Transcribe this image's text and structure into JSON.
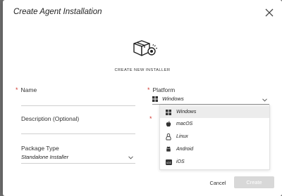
{
  "dialog": {
    "title": "Create Agent Installation",
    "hero_caption": "CREATE NEW INSTALLER"
  },
  "form": {
    "name": {
      "label": "Name",
      "required": "*"
    },
    "description": {
      "label": "Description (Optional)"
    },
    "package_type": {
      "label": "Package Type",
      "value": "Standalone Installer"
    },
    "platform": {
      "label": "Platform",
      "required": "*",
      "value": "Windows",
      "second_required": "*",
      "options": [
        {
          "label": "Windows",
          "icon": "windows-icon",
          "selected": true
        },
        {
          "label": "macOS",
          "icon": "apple-icon"
        },
        {
          "label": "Linux",
          "icon": "linux-icon"
        },
        {
          "label": "Android",
          "icon": "android-icon"
        },
        {
          "label": "iOS",
          "icon": "ios-icon"
        }
      ]
    }
  },
  "footer": {
    "cancel_label": "Cancel",
    "create_label": "Create"
  },
  "colors": {
    "required": "#d0342c",
    "create_disabled": "#d8d8d8",
    "selected_row": "#ececec"
  }
}
